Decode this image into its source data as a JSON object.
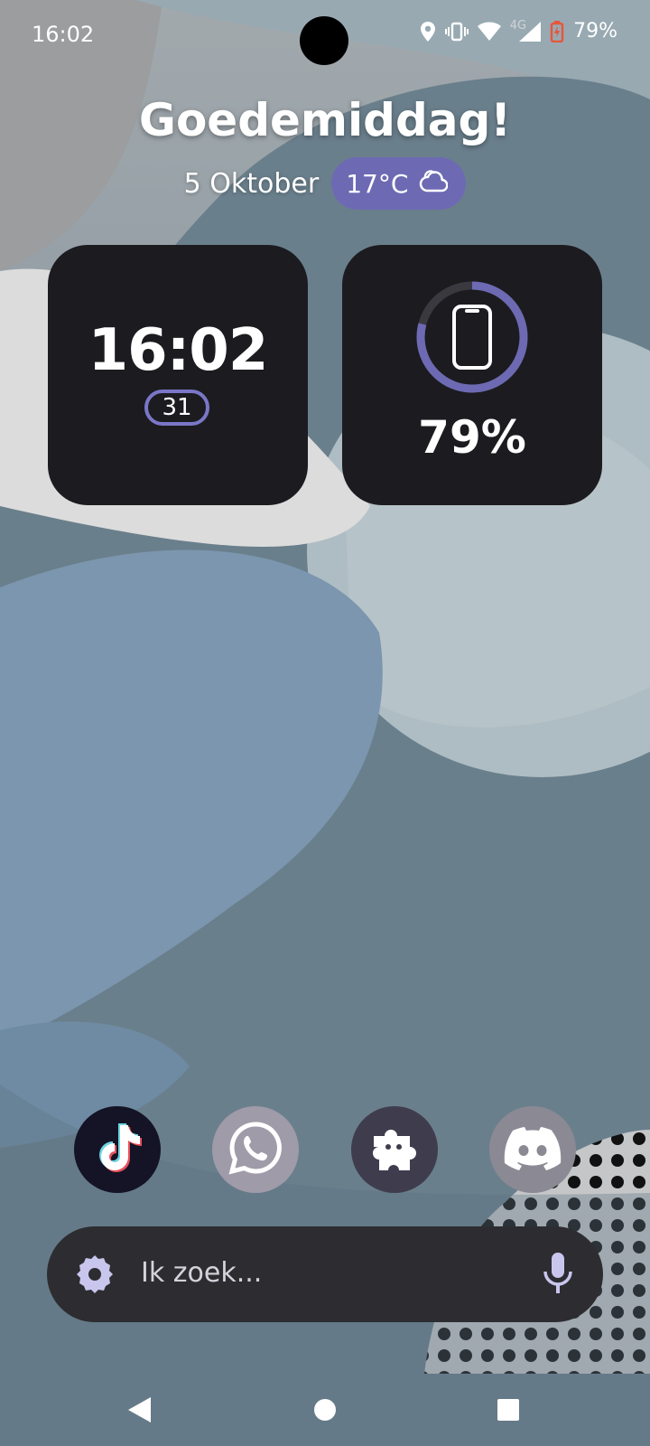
{
  "status_bar": {
    "time": "16:02",
    "battery_text": "79%",
    "network_label": "4G",
    "icons": [
      "location-icon",
      "vibrate-icon",
      "wifi-icon",
      "cell-signal-icon",
      "battery-charging-icon"
    ]
  },
  "header": {
    "greeting": "Goedemiddag!",
    "date": "5 Oktober",
    "weather": {
      "temperature": "17°C",
      "icon": "cloudy-icon"
    }
  },
  "clock_widget": {
    "time": "16:02",
    "day": "31"
  },
  "battery_widget": {
    "percent_text": "79%",
    "level": 0.79,
    "icon": "phone-icon"
  },
  "dock": {
    "apps": [
      {
        "name": "TikTok",
        "icon": "tiktok-icon"
      },
      {
        "name": "WhatsApp",
        "icon": "whatsapp-icon"
      },
      {
        "name": "Plugin",
        "icon": "puzzle-icon"
      },
      {
        "name": "Discord",
        "icon": "discord-icon"
      }
    ]
  },
  "search": {
    "placeholder": "Ik zoek..."
  },
  "colors": {
    "accent": "#6d6ab3",
    "widget_bg": "#1c1b20",
    "searchbar_bg": "#2d2d31",
    "battery_icon": "#e8553a"
  }
}
